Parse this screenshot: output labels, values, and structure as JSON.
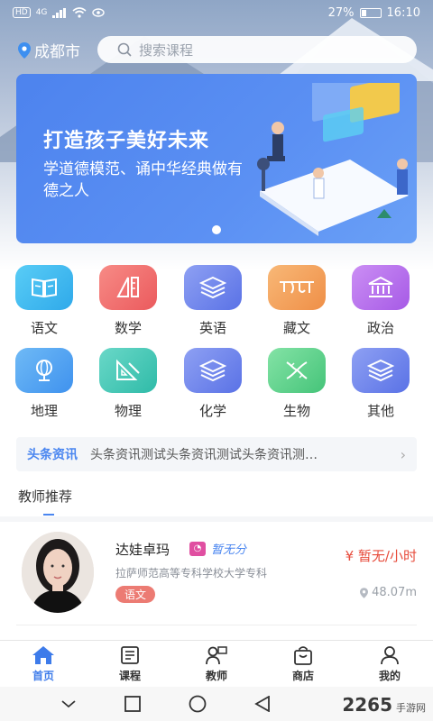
{
  "status_bar": {
    "left_chips": [
      "HD",
      "4G"
    ],
    "battery": "27%",
    "battery_level": 0.27,
    "time": "16:10"
  },
  "header": {
    "location": "成都市",
    "search_placeholder": "搜索课程"
  },
  "banner": {
    "title": "打造孩子美好未来",
    "subtitle": "学道德模范、诵中华经典做有德之人",
    "page_count": 1
  },
  "categories": [
    {
      "label": "语文",
      "icon": "book-icon",
      "color": "#38b7ee"
    },
    {
      "label": "数学",
      "icon": "ruler-icon",
      "color": "#f06d6d"
    },
    {
      "label": "英语",
      "icon": "layers-icon",
      "color": "#6e86ec"
    },
    {
      "label": "藏文",
      "icon": "tibetan-script-icon",
      "color": "#f3a35f"
    },
    {
      "label": "政治",
      "icon": "government-building-icon",
      "color": "#b76dec"
    },
    {
      "label": "地理",
      "icon": "globe-icon",
      "color": "#4aa6f0"
    },
    {
      "label": "物理",
      "icon": "set-square-icon",
      "color": "#3fc7b5"
    },
    {
      "label": "化学",
      "icon": "layers-icon",
      "color": "#6e86ec"
    },
    {
      "label": "生物",
      "icon": "dna-icon",
      "color": "#5fd08a"
    },
    {
      "label": "其他",
      "icon": "layers-icon",
      "color": "#6e86ec"
    }
  ],
  "news": {
    "tag": "头条资讯",
    "text": "头条资讯测试头条资讯测试头条资讯测…"
  },
  "teachers_section": {
    "title": "教师推荐"
  },
  "teacher": {
    "name": "达娃卓玛",
    "rating": "暂无分",
    "school": "拉萨师范高等专科学校大学专科",
    "subject": "语文",
    "price": "¥ 暂无/小时",
    "distance": "48.07m"
  },
  "tabbar": [
    {
      "label": "首页",
      "icon": "home-icon",
      "active": true
    },
    {
      "label": "课程",
      "icon": "course-icon",
      "active": false
    },
    {
      "label": "教师",
      "icon": "teacher-icon",
      "active": false
    },
    {
      "label": "商店",
      "icon": "shop-bag-icon",
      "active": false
    },
    {
      "label": "我的",
      "icon": "profile-icon",
      "active": false
    }
  ],
  "watermark": {
    "brand": "2265",
    "site": "手游网"
  }
}
